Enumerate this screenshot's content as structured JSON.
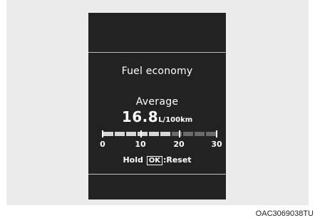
{
  "display": {
    "title": "Fuel economy",
    "average_label": "Average",
    "value": "16.8",
    "unit": "L/100km",
    "gauge": {
      "min": 0,
      "max": 30,
      "current": 16.8,
      "segments": 10,
      "filled_color": "#d8d8d8",
      "empty_color": "#6a6a6a",
      "tick_labels": [
        "0",
        "10",
        "20",
        "30"
      ]
    },
    "hold_text": "Hold",
    "ok_button": "OK",
    "reset_text": ":Reset"
  },
  "caption": "OAC3069038TU"
}
